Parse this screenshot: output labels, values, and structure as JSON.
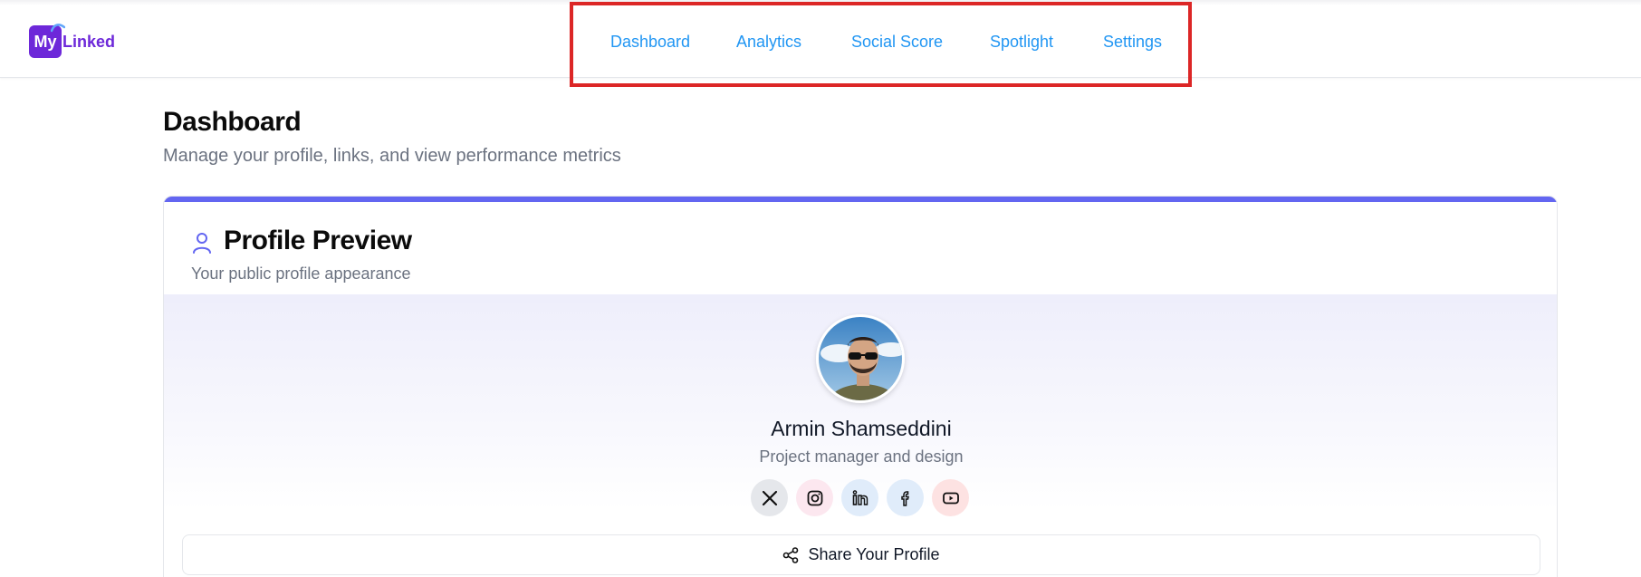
{
  "app": {
    "logo_text_boxed": "My",
    "logo_text": "Linked",
    "brand_color": "#6d28d9"
  },
  "nav": {
    "items": [
      {
        "label": "Dashboard"
      },
      {
        "label": "Analytics"
      },
      {
        "label": "Social Score"
      },
      {
        "label": "Spotlight"
      },
      {
        "label": "Settings"
      }
    ],
    "link_color": "#2196f3",
    "highlight_color": "#dc2626"
  },
  "page": {
    "title": "Dashboard",
    "subtitle": "Manage your profile, links, and view performance metrics"
  },
  "profile_card": {
    "icon": "user-icon",
    "title": "Profile Preview",
    "subtitle": "Your public profile appearance",
    "accent_color": "#6366f1",
    "name": "Armin Shamseddini",
    "role": "Project manager and design",
    "socials": [
      {
        "icon": "x-icon",
        "label": "X"
      },
      {
        "icon": "instagram-icon",
        "label": "Instagram"
      },
      {
        "icon": "linkedin-icon",
        "label": "LinkedIn"
      },
      {
        "icon": "facebook-icon",
        "label": "Facebook"
      },
      {
        "icon": "youtube-icon",
        "label": "YouTube"
      }
    ],
    "share_icon": "share-icon",
    "share_label": "Share Your Profile"
  }
}
